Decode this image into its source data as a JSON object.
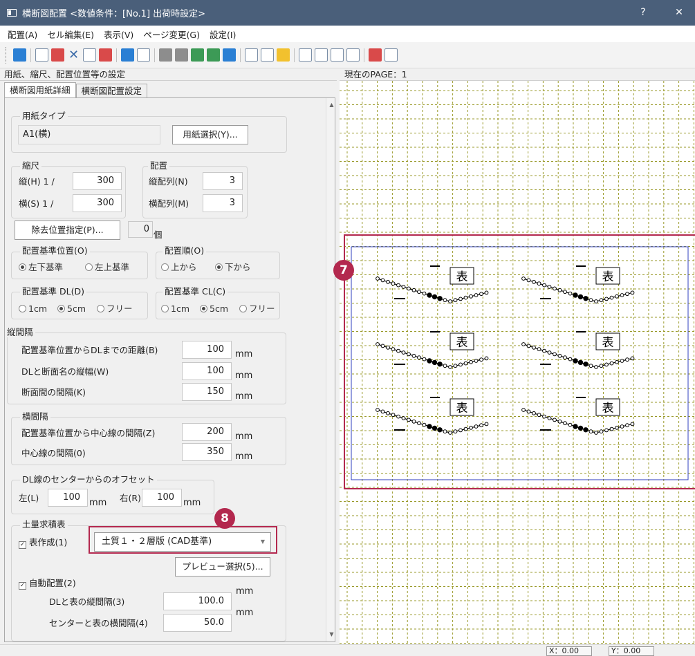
{
  "window": {
    "title": "横断図配置 <数値条件：[No.1] 出荷時設定>",
    "help_label": "?",
    "close_label": "✕"
  },
  "menu": [
    "配置(A)",
    "セル編集(E)",
    "表示(V)",
    "ページ変更(G)",
    "設定(I)"
  ],
  "toolbar": {
    "icons": [
      "open-icon",
      "layout-icon",
      "table-icon",
      "delete-icon",
      "edit-icon",
      "tool-icon",
      "insert-icon",
      "list-icon",
      "align-icon",
      "move-icon",
      "flip-icon",
      "flip2-icon",
      "flip3-icon",
      "zoom-icon",
      "fit-icon",
      "bulb-icon",
      "page-prev-icon",
      "page-next-icon",
      "page-add-icon",
      "grid-icon",
      "export-icon",
      "print-icon"
    ]
  },
  "left_panel": {
    "header": "用紙、縮尺、配置位置等の設定",
    "tabs": [
      "横断図用紙詳細",
      "横断図配置設定"
    ]
  },
  "paper": {
    "group_label": "用紙タイプ",
    "value": "A1(横)",
    "button": "用紙選択(Y)..."
  },
  "scale": {
    "group_label": "縮尺",
    "v_label": "縦(H) 1 /",
    "v_value": "300",
    "h_label": "横(S) 1 /",
    "h_value": "300"
  },
  "arrange": {
    "group_label": "配置",
    "v_label": "縦配列(N)",
    "v_value": "3",
    "h_label": "横配列(M)",
    "h_value": "3"
  },
  "removal": {
    "button": "除去位置指定(P)...",
    "count": "0",
    "unit": "個"
  },
  "base_position": {
    "label": "配置基準位置(O)",
    "options": [
      "左下基準",
      "左上基準"
    ],
    "selected": 0
  },
  "order": {
    "label": "配置順(O)",
    "options": [
      "上から",
      "下から"
    ],
    "selected": 1
  },
  "base_dl": {
    "label": "配置基準 DL(D)",
    "options": [
      "1cm",
      "5cm",
      "フリー"
    ],
    "selected": 1
  },
  "base_cl": {
    "label": "配置基準 CL(C)",
    "options": [
      "1cm",
      "5cm",
      "フリー"
    ],
    "selected": 1
  },
  "vertical_spacing": {
    "label": "縦間隔",
    "rows": [
      {
        "label": "配置基準位置からDLまでの距離(B)",
        "value": "100",
        "unit": "mm"
      },
      {
        "label": "DLと断面名の縦幅(W)",
        "value": "100",
        "unit": "mm"
      },
      {
        "label": "断面間の間隔(K)",
        "value": "150",
        "unit": "mm"
      }
    ]
  },
  "horizontal_spacing": {
    "label": "横間隔",
    "rows": [
      {
        "label": "配置基準位置から中心線の間隔(Z)",
        "value": "200",
        "unit": "mm"
      },
      {
        "label": "中心線の間隔(0)",
        "value": "350",
        "unit": "mm"
      }
    ]
  },
  "offset": {
    "label": "DL線のセンターからのオフセット",
    "left_label": "左(L)",
    "left_value": "100",
    "right_label": "右(R)",
    "right_value": "100",
    "unit": "mm"
  },
  "earthwork": {
    "label": "土量求積表",
    "create_label": "表作成(1)",
    "create_checked": true,
    "format_value": "土質１・２層版 (CAD基準)",
    "preview_button": "プレビュー選択(5)...",
    "auto_label": "自動配置(2)",
    "auto_checked": true,
    "dl_table_label": "DLと表の縦間隔(3)",
    "dl_table_value": "100.0",
    "center_table_label": "センターと表の横間隔(4)",
    "center_table_value": "50.0",
    "unit": "mm"
  },
  "badges": {
    "b7": "7",
    "b8": "8"
  },
  "accent_color": "#b3284e",
  "preview": {
    "header": "現在のPAGE：1",
    "table_char": "表"
  },
  "status": {
    "x": "X：0.00",
    "y": "Y：0.00"
  }
}
